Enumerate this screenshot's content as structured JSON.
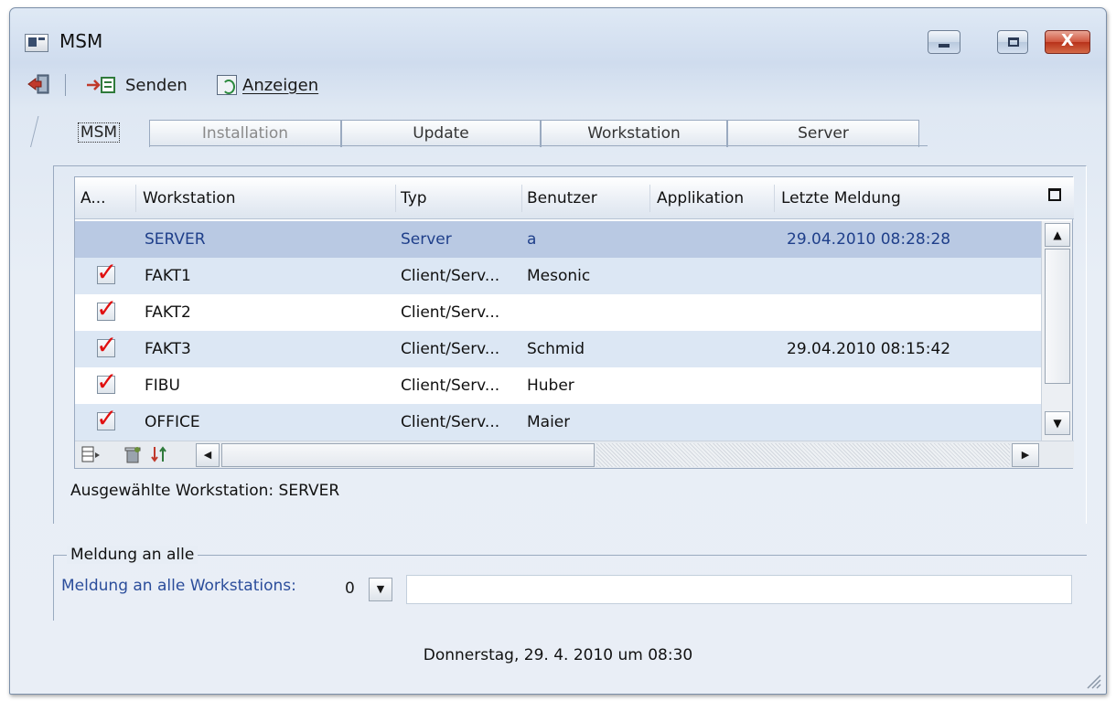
{
  "window": {
    "title": "MSM",
    "close_label": "X"
  },
  "toolbar": {
    "send_label": "Senden",
    "show_label": "Anzeigen"
  },
  "tabs": [
    {
      "label": "MSM",
      "state": "active"
    },
    {
      "label": "Installation",
      "state": "disabled"
    },
    {
      "label": "Update",
      "state": "normal"
    },
    {
      "label": "Workstation",
      "state": "normal"
    },
    {
      "label": "Server",
      "state": "normal"
    }
  ],
  "grid": {
    "columns": [
      "A...",
      "Workstation",
      "Typ",
      "Benutzer",
      "Applikation",
      "Letzte Meldung"
    ],
    "rows": [
      {
        "checked": false,
        "workstation": "SERVER",
        "typ": "Server",
        "benutzer": "a",
        "applikation": "",
        "letzte_meldung": "29.04.2010 08:28:28",
        "selected": true
      },
      {
        "checked": true,
        "workstation": "FAKT1",
        "typ": "Client/Serv...",
        "benutzer": "Mesonic",
        "applikation": "",
        "letzte_meldung": ""
      },
      {
        "checked": true,
        "workstation": "FAKT2",
        "typ": "Client/Serv...",
        "benutzer": "",
        "applikation": "",
        "letzte_meldung": ""
      },
      {
        "checked": true,
        "workstation": "FAKT3",
        "typ": "Client/Serv...",
        "benutzer": "Schmid",
        "applikation": "",
        "letzte_meldung": "29.04.2010 08:15:42"
      },
      {
        "checked": true,
        "workstation": "FIBU",
        "typ": "Client/Serv...",
        "benutzer": "Huber",
        "applikation": "",
        "letzte_meldung": ""
      },
      {
        "checked": true,
        "workstation": "OFFICE",
        "typ": "Client/Serv...",
        "benutzer": "Maier",
        "applikation": "",
        "letzte_meldung": ""
      }
    ]
  },
  "selected_workstation": "Ausgewählte Workstation:  SERVER",
  "broadcast": {
    "legend": "Meldung an alle",
    "label": "Meldung an alle Workstations:",
    "value": "0",
    "message": ""
  },
  "status_date": "Donnerstag, 29. 4. 2010 um 08:30",
  "colors": {
    "selected_row": "#b9c9e3",
    "alt_row": "#dce7f4",
    "check": "#e01010",
    "label_blue": "#2b4d9b"
  }
}
